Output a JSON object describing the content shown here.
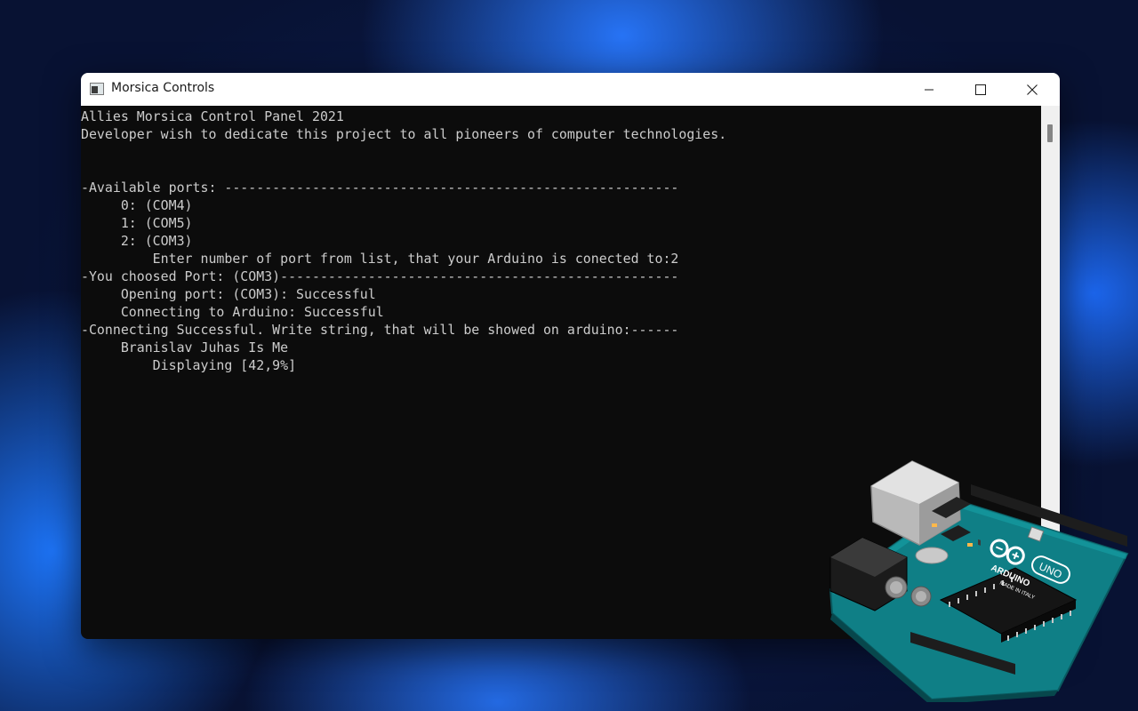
{
  "window": {
    "title": "Morsica Controls",
    "icon": "console-app-icon"
  },
  "controls": {
    "minimize_icon": "minimize-icon",
    "maximize_icon": "maximize-icon",
    "close_icon": "close-icon"
  },
  "console": {
    "lines": [
      "Allies Morsica Control Panel 2021",
      "Developer wish to dedicate this project to all pioneers of computer technologies.",
      "",
      "",
      "-Available ports: ---------------------------------------------------------",
      "     0: (COM4)",
      "     1: (COM5)",
      "     2: (COM3)",
      "         Enter number of port from list, that your Arduino is conected to:2",
      "-You choosed Port: (COM3)--------------------------------------------------",
      "     Opening port: (COM3): Successful",
      "     Connecting to Arduino: Successful",
      "-Connecting Successful. Write string, that will be showed on arduino:------",
      "     Branislav Juhas Is Me",
      "         Displaying [42,9%]"
    ]
  },
  "colors": {
    "console_bg": "#0c0c0c",
    "console_text": "#cccccc",
    "titlebar_bg": "#ffffff",
    "board_teal": "#0f7f86"
  },
  "image": {
    "name": "arduino-uno-board",
    "board_brand": "ARDUINO",
    "board_model": "UNO",
    "board_made": "MADE IN ITALY"
  }
}
